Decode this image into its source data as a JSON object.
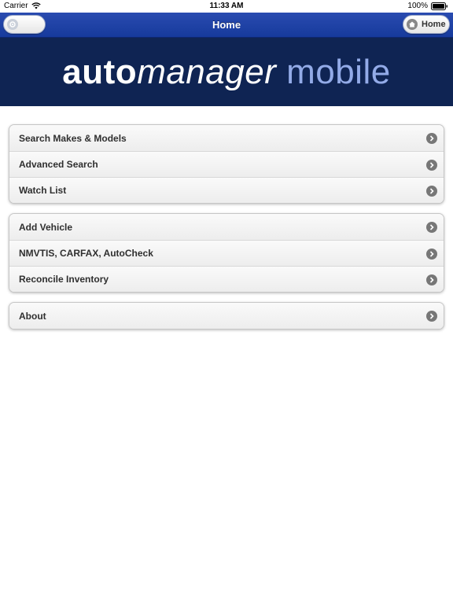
{
  "status_bar": {
    "carrier": "Carrier",
    "time": "11:33 AM",
    "battery": "100%"
  },
  "nav": {
    "title": "Home",
    "home_button_label": "Home",
    "settings_icon": "gear-icon",
    "home_icon": "home-icon"
  },
  "banner": {
    "part1": "auto",
    "part2": "manager",
    "part3": " mobile",
    "color_accent": "#93abe8",
    "color_background": "#0f2453"
  },
  "menu": {
    "group1": [
      {
        "label": "Search Makes & Models"
      },
      {
        "label": "Advanced Search"
      },
      {
        "label": "Watch List"
      }
    ],
    "group2": [
      {
        "label": "Add Vehicle"
      },
      {
        "label": "NMVTIS, CARFAX, AutoCheck"
      },
      {
        "label": "Reconcile Inventory"
      }
    ],
    "group3": [
      {
        "label": "About"
      }
    ]
  },
  "colors": {
    "nav_bar": "#1f44a8"
  }
}
